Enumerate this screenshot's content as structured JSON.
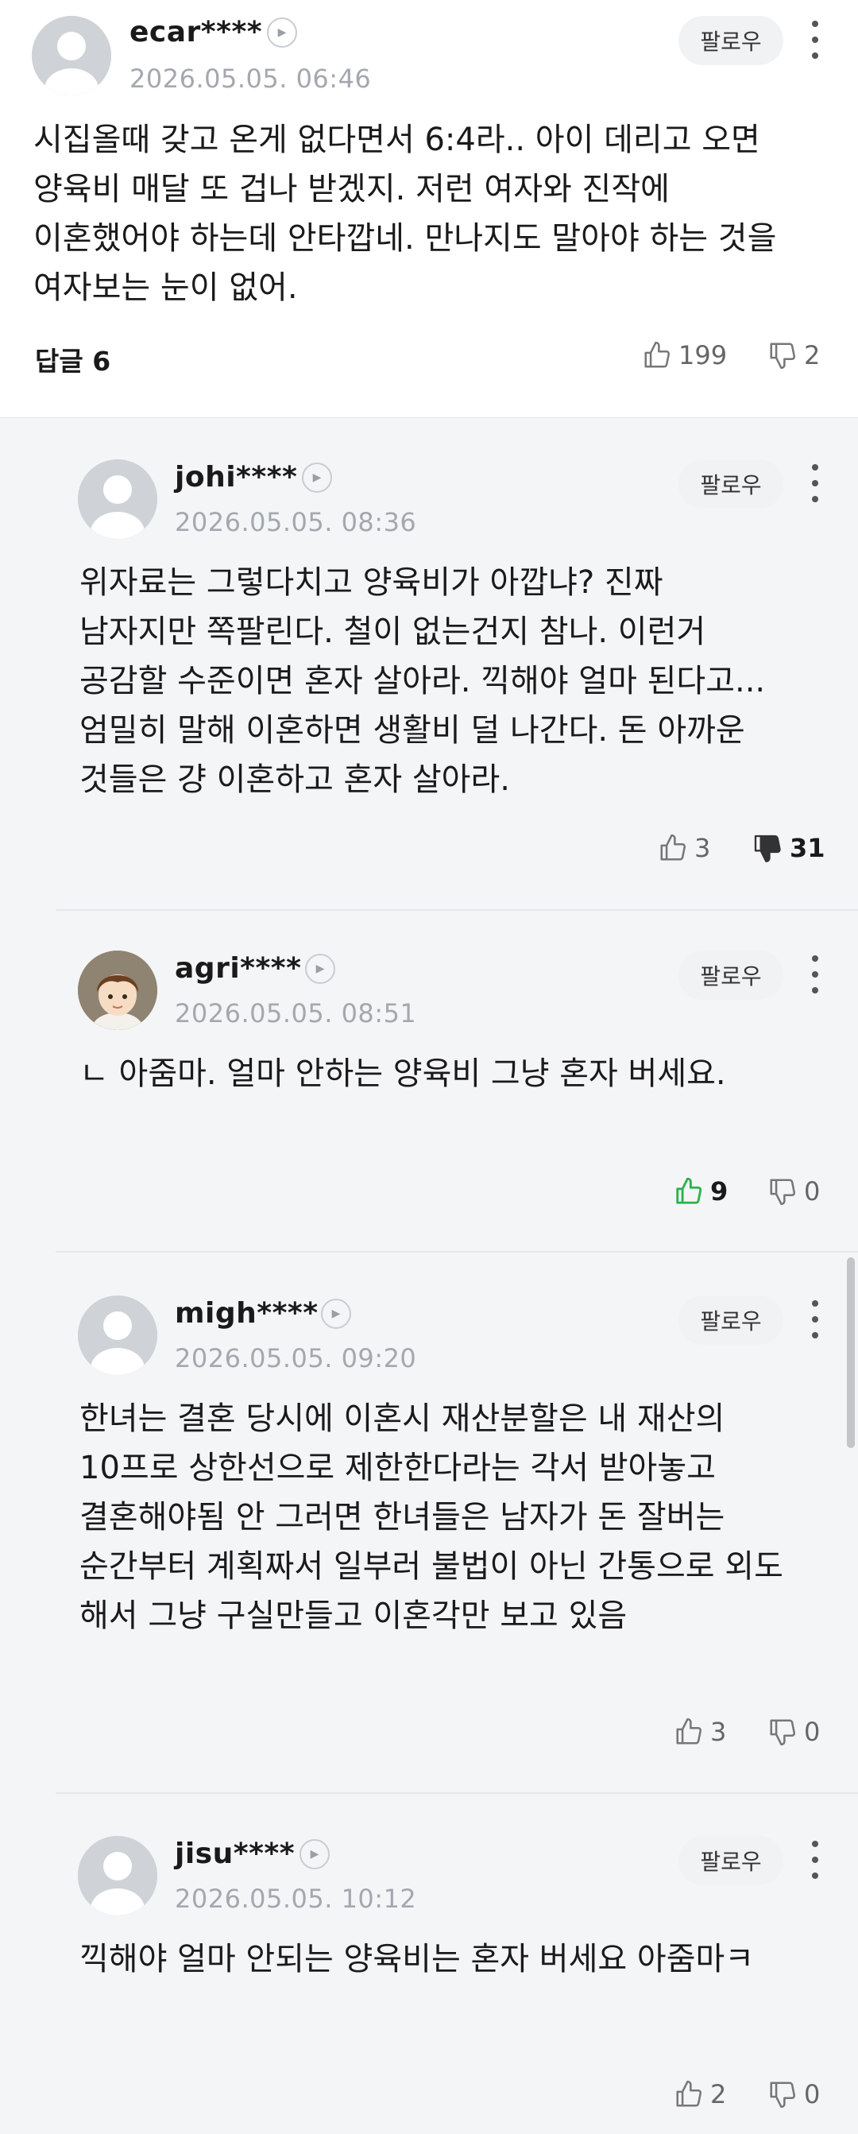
{
  "main_comment": {
    "username": "ecar****",
    "timestamp": "2026.05.05. 06:46",
    "follow_label": "팔로우",
    "text": "시집올때 갖고 온게 없다면서 6:4라.. 아이 데리고 오면 양육비 매달 또 겁나 받겠지. 저런 여자와 진작에 이혼했어야 하는데 안타깝네. 만나지도 말아야 하는 것을 여자보는 눈이 없어.",
    "reply_label": "답글 6",
    "likes": "199",
    "dislikes": "2"
  },
  "replies": [
    {
      "username": "johi****",
      "timestamp": "2026.05.05. 08:36",
      "follow_label": "팔로우",
      "text": "위자료는 그렇다치고 양육비가 아깝냐? 진짜 남자지만 쪽팔린다. 철이 없는건지 참나. 이런거 공감할 수준이면 혼자 살아라. 끽해야 얼마 된다고... 엄밀히 말해 이혼하면 생활비 덜 나간다. 돈 아까운 것들은 걍 이혼하고 혼자 살아라.",
      "likes": "3",
      "dislikes": "31",
      "voted": "down",
      "avatar": "default-avatar-icon"
    },
    {
      "username": "agri****",
      "timestamp": "2026.05.05. 08:51",
      "follow_label": "팔로우",
      "text": "ㄴ 아줌마. 얼마 안하는 양육비 그냥 혼자 버세요.",
      "likes": "9",
      "dislikes": "0",
      "voted": "up",
      "avatar": "character-avatar-icon"
    },
    {
      "username": "migh****",
      "timestamp": "2026.05.05. 09:20",
      "follow_label": "팔로우",
      "text": "한녀는 결혼 당시에 이혼시 재산분할은 내 재산의 10프로 상한선으로 제한한다라는 각서 받아놓고 결혼해야됨 안 그러면 한녀들은 남자가 돈 잘버는 순간부터 계획짜서 일부러 불법이 아닌 간통으로 외도 해서 그냥 구실만들고 이혼각만 보고 있음",
      "likes": "3",
      "dislikes": "0",
      "voted": "none",
      "avatar": "default-avatar-icon"
    },
    {
      "username": "jisu****",
      "timestamp": "2026.05.05. 10:12",
      "follow_label": "팔로우",
      "text": "끽해야 얼마 안되는 양육비는 혼자 버세요 아줌마ㅋ",
      "likes": "2",
      "dislikes": "0",
      "voted": "none",
      "avatar": "default-avatar-icon"
    }
  ],
  "colors": {
    "upvote_active": "#2bb24c",
    "downvote_active": "#333333",
    "timestamp": "#a4a8ae"
  }
}
